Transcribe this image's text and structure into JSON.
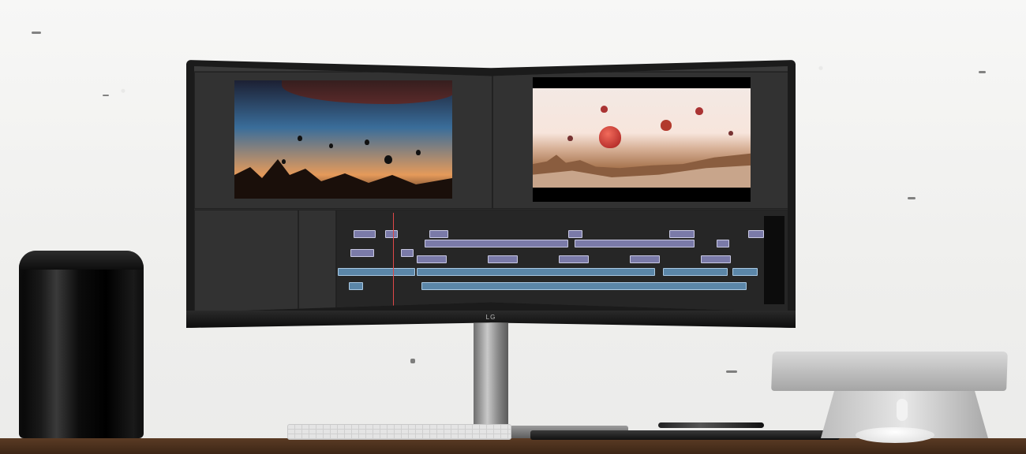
{
  "monitor": {
    "brand_logo": "LG"
  },
  "colors": {
    "wall": "#f3f3f1",
    "desk": "#4a2f1c",
    "editor_bg": "#2b2b2b",
    "video_clip": "#7a7aa8",
    "audio_clip": "#5b86a8",
    "playhead": "#e04848"
  }
}
